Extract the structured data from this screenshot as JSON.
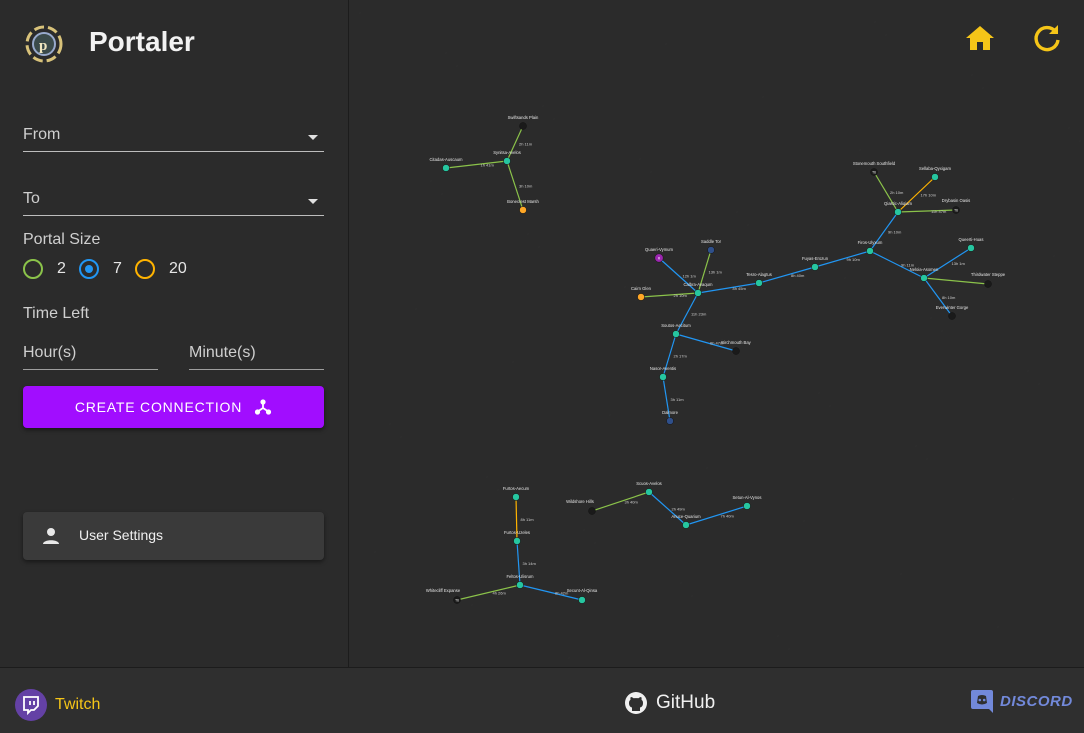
{
  "app": {
    "title": "Portaler"
  },
  "form": {
    "from_label": "From",
    "to_label": "To",
    "portal_size_label": "Portal Size",
    "portal_sizes": [
      {
        "label": "2",
        "color": "#8bc34a",
        "selected": false
      },
      {
        "label": "7",
        "color": "#2196f3",
        "selected": true
      },
      {
        "label": "20",
        "color": "#ffb300",
        "selected": false
      }
    ],
    "time_left_label": "Time Left",
    "hours_placeholder": "Hour(s)",
    "minutes_placeholder": "Minute(s)",
    "create_button": "CREATE CONNECTION"
  },
  "settings": {
    "label": "User Settings"
  },
  "toolbar": {
    "home_icon": "home-icon",
    "refresh_icon": "refresh-icon",
    "accent": "#f5c518"
  },
  "footer": {
    "twitch": "Twitch",
    "github": "GitHub",
    "discord": "DISCORD"
  },
  "map": {
    "nodes": [
      {
        "id": "swiftsands",
        "label": "Swiftsands Plain",
        "type": "black",
        "tag": ""
      },
      {
        "id": "synitsa",
        "label": "Synitsa-Avelos",
        "type": "green",
        "tag": ""
      },
      {
        "id": "citadas",
        "label": "Citadas-Auscaum",
        "type": "green",
        "tag": ""
      },
      {
        "id": "bonecrest",
        "label": "Bonecrest Marsh",
        "type": "orange",
        "tag": ""
      },
      {
        "id": "stonemouth",
        "label": "Stonemouth Southfield",
        "type": "black",
        "tag": "T6"
      },
      {
        "id": "sellaba",
        "label": "Sellaba-Qyxigam",
        "type": "green",
        "tag": ""
      },
      {
        "id": "qiastic",
        "label": "Qiastic-Aliqiam",
        "type": "green",
        "tag": ""
      },
      {
        "id": "drybasin",
        "label": "Drybasin Oasis",
        "type": "black",
        "tag": "T6"
      },
      {
        "id": "firos",
        "label": "Firos-Ulyxum",
        "type": "green",
        "tag": ""
      },
      {
        "id": "queeri",
        "label": "Queerti-Huas",
        "type": "green",
        "tag": ""
      },
      {
        "id": "fuyas",
        "label": "Fuyas-Erozun",
        "type": "green",
        "tag": ""
      },
      {
        "id": "neloia",
        "label": "Neloia-Asomen",
        "type": "green",
        "tag": ""
      },
      {
        "id": "thirdwater",
        "label": "Thirdwater Steppe",
        "type": "black",
        "tag": ""
      },
      {
        "id": "everwinter",
        "label": "Everwinter Gorge",
        "type": "black",
        "tag": ""
      },
      {
        "id": "tesro",
        "label": "Tesro-Alagtus",
        "type": "green",
        "tag": ""
      },
      {
        "id": "quaeri",
        "label": "Quaeri-Vymum",
        "type": "purple",
        "tag": "R"
      },
      {
        "id": "saddle",
        "label": "Saddle Tor",
        "type": "navy",
        "tag": ""
      },
      {
        "id": "calbra",
        "label": "Calbra-Avaqum",
        "type": "green",
        "tag": ""
      },
      {
        "id": "cairn",
        "label": "Cairn Glen",
        "type": "orange",
        "tag": ""
      },
      {
        "id": "soutos",
        "label": "Soutos-Aecitum",
        "type": "green",
        "tag": ""
      },
      {
        "id": "birchmouth",
        "label": "Birchmouth Bay",
        "type": "black",
        "tag": ""
      },
      {
        "id": "nasor",
        "label": "Nasor-Aventis",
        "type": "green",
        "tag": ""
      },
      {
        "id": "dalmore",
        "label": "Dalmore",
        "type": "navy",
        "tag": ""
      },
      {
        "id": "furtos",
        "label": "Furtos-Aecum",
        "type": "green",
        "tag": ""
      },
      {
        "id": "furtoscitm",
        "label": "Furtos-Uzeles",
        "type": "green",
        "tag": ""
      },
      {
        "id": "feltos",
        "label": "Feltos-Ulisrum",
        "type": "green",
        "tag": ""
      },
      {
        "id": "whitecliff",
        "label": "Whitecliff Expanse",
        "type": "black",
        "tag": "T6"
      },
      {
        "id": "secunt",
        "label": "Secunt-Al-Qinsa",
        "type": "green",
        "tag": ""
      },
      {
        "id": "wildshore",
        "label": "Wildshore Hills",
        "type": "black",
        "tag": ""
      },
      {
        "id": "scuos",
        "label": "Scuos-Avelos",
        "type": "green",
        "tag": ""
      },
      {
        "id": "anuce",
        "label": "Anuce-Quarium",
        "type": "green",
        "tag": ""
      },
      {
        "id": "setun",
        "label": "Setun-Al-Vynos",
        "type": "green",
        "tag": ""
      }
    ],
    "edges": [
      {
        "from": "swiftsands",
        "to": "synitsa",
        "size": "2",
        "time": "2h 11m"
      },
      {
        "from": "citadas",
        "to": "synitsa",
        "size": "2",
        "time": "1h 41m"
      },
      {
        "from": "synitsa",
        "to": "bonecrest",
        "size": "2",
        "time": "3h 10m"
      },
      {
        "from": "stonemouth",
        "to": "qiastic",
        "size": "2",
        "time": "2h 10m"
      },
      {
        "from": "sellaba",
        "to": "qiastic",
        "size": "20",
        "time": "17h 10m"
      },
      {
        "from": "qiastic",
        "to": "drybasin",
        "size": "2",
        "time": "11h 47m"
      },
      {
        "from": "qiastic",
        "to": "firos",
        "size": "7",
        "time": "9h 10m"
      },
      {
        "from": "queeri",
        "to": "neloia",
        "size": "7",
        "time": "13h 1m"
      },
      {
        "from": "firos",
        "to": "neloia",
        "size": "7",
        "time": "9h 11m"
      },
      {
        "from": "neloia",
        "to": "thirdwater",
        "size": "2",
        "time": ""
      },
      {
        "from": "neloia",
        "to": "everwinter",
        "size": "7",
        "time": "8h 10m"
      },
      {
        "from": "firos",
        "to": "fuyas",
        "size": "7",
        "time": "9h 10m"
      },
      {
        "from": "fuyas",
        "to": "tesro",
        "size": "7",
        "time": "8h 40m"
      },
      {
        "from": "tesro",
        "to": "calbra",
        "size": "7",
        "time": "8h 45m"
      },
      {
        "from": "quaeri",
        "to": "calbra",
        "size": "7",
        "time": "12h 1m"
      },
      {
        "from": "saddle",
        "to": "calbra",
        "size": "2",
        "time": "13h 1m"
      },
      {
        "from": "cairn",
        "to": "calbra",
        "size": "2",
        "time": "2h 10m"
      },
      {
        "from": "calbra",
        "to": "soutos",
        "size": "7",
        "time": "11h 23m"
      },
      {
        "from": "soutos",
        "to": "birchmouth",
        "size": "7",
        "time": "6h 47m"
      },
      {
        "from": "soutos",
        "to": "nasor",
        "size": "7",
        "time": "2h 17m"
      },
      {
        "from": "nasor",
        "to": "dalmore",
        "size": "7",
        "time": "3h 11m"
      },
      {
        "from": "furtos",
        "to": "furtoscitm",
        "size": "20",
        "time": "8h 11m"
      },
      {
        "from": "furtoscitm",
        "to": "feltos",
        "size": "7",
        "time": "3h 14m"
      },
      {
        "from": "whitecliff",
        "to": "feltos",
        "size": "2",
        "time": "4h 26m"
      },
      {
        "from": "feltos",
        "to": "secunt",
        "size": "7",
        "time": "8h 42m"
      },
      {
        "from": "wildshore",
        "to": "scuos",
        "size": "2",
        "time": "3h 40m"
      },
      {
        "from": "scuos",
        "to": "anuce",
        "size": "7",
        "time": "2h 49m"
      },
      {
        "from": "anuce",
        "to": "setun",
        "size": "7",
        "time": "7h 40m"
      }
    ]
  }
}
